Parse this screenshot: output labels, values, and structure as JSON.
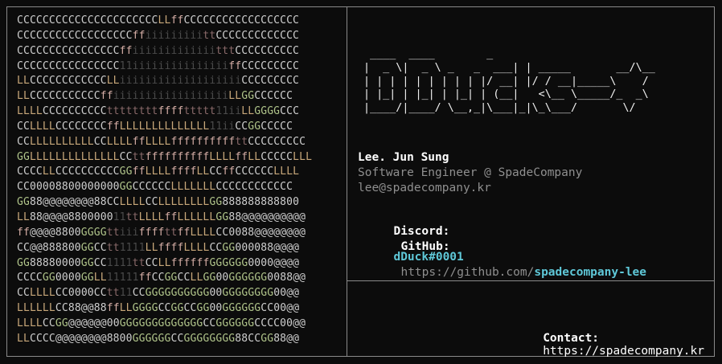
{
  "ascii_art": [
    "CCCCCCCCCCCCCCCCCCCCCCLLffCCCCCCCCCCCCCCCCCC",
    "CCCCCCCCCCCCCCCCCCffiiiiiiiiittCCCCCCCCCCCCC",
    "CCCCCCCCCCCCCCCCffiiiiiiiiiiiiitttCCCCCCCCCC",
    "CCCCCCCCCCCCCCCC11iiiiiiiiiiiiiiiffCCCCCCCCC",
    "LLCCCCCCCCCCCCLLiiiiiiiiiiiiiiiiiiiCCCCCCCCC",
    "LLCCCCCCCCCCCffiiiiiiiiiiiiiiiiiiLLGGCCCCCC",
    "LLLLCCCCCCCCCCttttttttffffttttt11iiLLGGGGCCC",
    "CCLLLLCCCCCCCCffLLLLLLLLLLLLLL11iiCCGGCCCCC",
    "CCLLLLLLLLLLCCLLLLffLLLLffffffffffttCCCCCCCCC",
    "GGLLLLLLLLLLLLLLCCttffffffffffLLLLffLLCCCCCLLL",
    "CCCCLLCCCCCCCCCCGGffLLLLffffLLCCffCCCCCCLLLL",
    "CC00008800000000GGCCCCCCLLLLLLLCCCCCCCCCCCC",
    "GG88@@@@@@@@88CCLLLLCCLLLLLLLLGG888888888800",
    "LL88@@@@880000011ttLLLLffLLLLLLGG88@@@@@@@@@@",
    "ff@@@@8800GGGGttiiiffffttffLLLLCC0088@@@@@@@@",
    "CC@@888800GGCCtt1111LLffffLLLLCCGG000088@@@@",
    "GG88880000GGCC1111ttCCLLffffffGGGGGG0000@@@@",
    "CCCCGG0000GGLL11111ffCCGGCCLLGG00GGGGGG0088@@",
    "CCLLLLCC0000CCtt11CCGGGGGGGGGG00GGGGGGGG00@@",
    "LLLLLLCC88@@88ffLLGGGGCCGGCCGG00GGGGGGCC00@@",
    "LLLLCCGG@@@@@@00GGGGGGGGGGGGGCCGGGGGGCCCC00@@",
    "LLCCCC@@@@@@@@8800GGGGGGCCGGGGGGGG88CCGG88@@"
  ],
  "logo_ascii": [
    " ____  ____        _           ",
    "|  _ \\|  _ \\ _   _  ___| | _____       __/\\__",
    "| | | | | | | | | |/ __| |/ / __|_____\\    /",
    "| |_| | |_| | |_| | (__|   <\\__ \\_____/_  _\\",
    "|____/|____/ \\__,_|\\___|_|\\_\\___/       \\/  "
  ],
  "profile": {
    "name": "Lee. Jun Sung",
    "role": "Software Engineer @ SpadeCompany",
    "email": "lee@spadecompany.kr"
  },
  "links": {
    "discord_label": "Discord:",
    "discord_value": "dDuck#0001",
    "github_label": "GitHub:",
    "github_prefix": "https://github.com/",
    "github_user": "spadecompany-lee"
  },
  "contact": {
    "label": "Contact:",
    "url": "https://spadecompany.kr"
  },
  "colors": {
    "background": "#0c0c0c",
    "border": "#8a8a8a",
    "accent": "#5fc8d8",
    "muted": "#8f8f8f"
  }
}
